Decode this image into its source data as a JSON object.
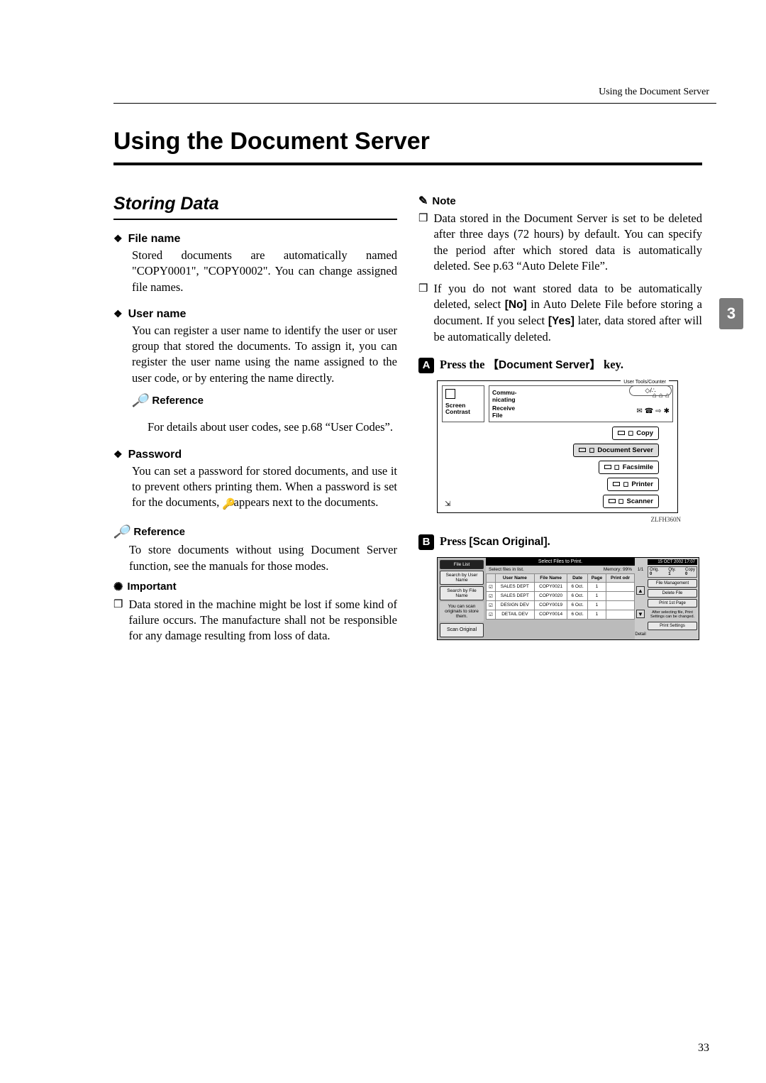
{
  "header": {
    "running": "Using the Document Server"
  },
  "title": "Using the Document Server",
  "side_tab": "3",
  "left": {
    "section_title": "Storing Data",
    "items": [
      {
        "head": "File name",
        "body": "Stored documents are automatically named \"COPY0001\", \"COPY0002\". You can change assigned file names."
      },
      {
        "head": "User name",
        "body": "You can register a user name to identify the user or user group that stored the documents. To assign it, you can register the user name using the name assigned to the user code, or by entering the name directly.",
        "ref_label": "Reference",
        "ref_body": "For details about user codes, see p.68 “User Codes”."
      },
      {
        "head": "Password",
        "body_a": "You can set a password for stored documents, and use it to prevent others printing them. When a password is set for the documents, ",
        "body_b": " appears next to the documents."
      }
    ],
    "ref2_label": "Reference",
    "ref2_body": "To store documents without using Document Server function, see the manuals for those modes.",
    "important_label": "Important",
    "important_item": "Data stored in the machine might be lost if some kind of failure occurs. The manufacture shall not be responsible for any damage resulting from loss of data."
  },
  "right": {
    "note_label": "Note",
    "note_items": [
      "Data stored in the Document Server is set to be deleted after three days (72 hours) by default. You can specify the period after which stored data is automatically deleted. See p.63 “Auto Delete File”.",
      {
        "pre": "If you do not want stored data to be automatically deleted, select ",
        "no": "[No]",
        "mid": " in Auto Delete File before storing a document. If you select ",
        "yes": "[Yes]",
        "post": " later, data stored after will be automatically deleted."
      }
    ],
    "step1": {
      "num": "A",
      "pre": "Press the ",
      "key": "Document Server",
      "post": " key."
    },
    "panel": {
      "top_label": "User Tools/Counter",
      "counter_pill": "◇/∴",
      "left_stack": {
        "l1": "Screen",
        "l2": "Contrast"
      },
      "status": {
        "r1_label": "Commu-\nnicating",
        "r1_icons": [
          "⌂",
          "⌂",
          "⌂"
        ],
        "r2_label": "Receive\nFile",
        "r2_icons": [
          "✉",
          "☎",
          "⇨",
          "✱"
        ]
      },
      "buttons": [
        "Copy",
        "Document Server",
        "Facsimile",
        "Printer",
        "Scanner"
      ],
      "caption": "ZLFH360N"
    },
    "step2": {
      "num": "B",
      "pre": "Press ",
      "btn": "[Scan Original]",
      "post": "."
    },
    "screen": {
      "left_buttons": [
        "File List",
        "Search by User Name",
        "Search by File Name"
      ],
      "left_tall": "You can scan originals to store them.",
      "left_scan": "Scan Original",
      "title_bar": "Select Files to Print.",
      "sub_left": "Select files in list.",
      "sub_right": "Memory: 99%",
      "columns": [
        "",
        "User Name",
        "File Name",
        "Date",
        "Page",
        "Print odr"
      ],
      "rows": [
        [
          "☑",
          "SALES DEPT",
          "COPY0021",
          "6 Oct.",
          "1",
          ""
        ],
        [
          "☑",
          "SALES DEPT",
          "COPY0020",
          "6 Oct.",
          "1",
          ""
        ],
        [
          "☑",
          "DESIGN DEV",
          "COPY0019",
          "6 Oct.",
          "1",
          ""
        ],
        [
          "☑",
          "DETAIL DEV",
          "COPY0014",
          "6 Oct.",
          "1",
          ""
        ]
      ],
      "scroll": {
        "up": "▲",
        "down": "▼",
        "label_top": "1/1",
        "label_bot": "Detail"
      },
      "right_topbar": "15 OCT 2002 17:07",
      "right_counter": {
        "c1l": "Orig.",
        "c1v": "0",
        "c2l": "Qty.",
        "c2v": "1",
        "c3l": "Copy",
        "c3v": "0"
      },
      "right_buttons": [
        "File Management",
        "Delete File",
        "Print 1st Page",
        "After selecting file, Print Settings can be changed.",
        "Print Settings"
      ]
    }
  },
  "page_number": "33"
}
